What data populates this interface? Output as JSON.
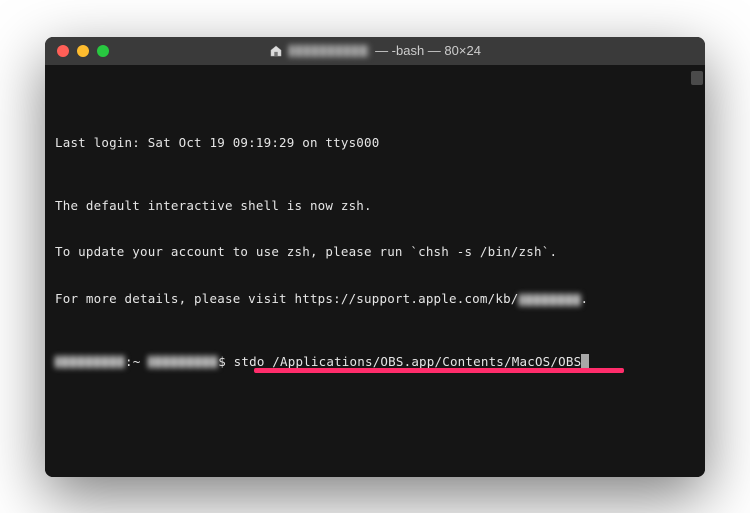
{
  "titlebar": {
    "title_suffix": " — -bash — 80×24"
  },
  "terminal": {
    "last_login": "Last login: Sat Oct 19 09:19:29 on ttys000",
    "msg1": "The default interactive shell is now zsh.",
    "msg2": "To update your account to use zsh, please run `chsh -s /bin/zsh`.",
    "msg3_prefix": "For more details, please visit https://support.apple.com/kb/",
    "msg3_suffix": ".",
    "prompt_colon_tilde": ":~ ",
    "prompt_dollar": "$ ",
    "command": "stdo /Applications/OBS.app/Contents/MacOS/OBS"
  }
}
